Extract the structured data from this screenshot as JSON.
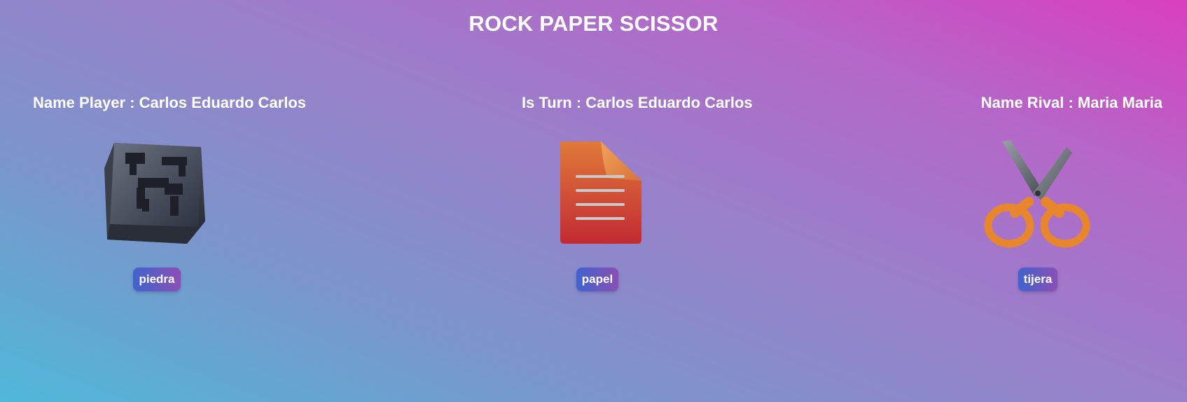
{
  "header": {
    "title": "ROCK PAPER SCISSOR"
  },
  "status": {
    "player_label": "Name Player : Carlos Eduardo Carlos",
    "turn_label": "Is Turn : Carlos Eduardo Carlos",
    "rival_label": "Name Rival : Maria Maria"
  },
  "choices": [
    {
      "label": "piedra",
      "icon": "rock-cube-icon"
    },
    {
      "label": "papel",
      "icon": "paper-document-icon"
    },
    {
      "label": "tijera",
      "icon": "scissors-icon"
    }
  ],
  "colors": {
    "background_start": "#4fb8d8",
    "background_end": "#d93fbf",
    "button_start": "#3f63cf",
    "button_end": "#8a4fb5"
  }
}
